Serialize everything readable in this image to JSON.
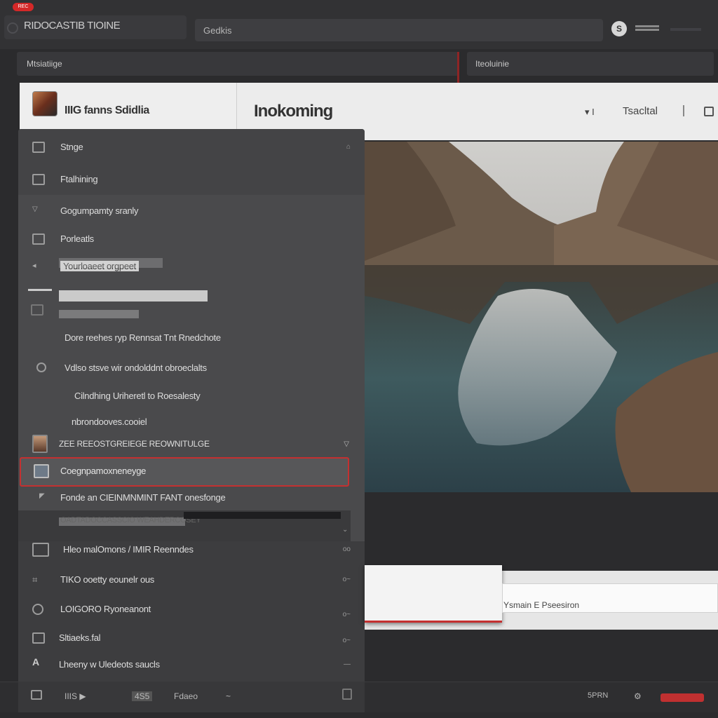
{
  "topbar": {
    "badge": "REC",
    "app_title": "RIDOCASTIB TIOINE",
    "search_text": "Gedkis",
    "circle_icon": "S",
    "menu_icon": "menu-icon"
  },
  "crumbs": {
    "left": "Mtsiatiige",
    "right": "Iteoluinie"
  },
  "header": {
    "studio_name": "IIIG fanns Sdidlia",
    "title": "Inokoming",
    "icon1": "▾ I",
    "link": "Tsacltal",
    "icon2": "layout-icon"
  },
  "sidebar": {
    "top_items": [
      {
        "label": "Stnge",
        "right": "⌂"
      },
      {
        "label": "Ftalhining",
        "right": ""
      }
    ],
    "items": [
      {
        "label": "Gogumpamty sranly",
        "right": ""
      },
      {
        "label": "Porleatls",
        "right": ""
      },
      {
        "label": "Yourloaeet orgpeet",
        "right": ""
      },
      {
        "label": "",
        "right": ""
      },
      {
        "label": "",
        "right": ""
      },
      {
        "label": "Dore reehes ryp Rennsat Tnt Rnedchote",
        "right": ""
      },
      {
        "label": "Vdlso stsve wir ondolddnt obroeclalts",
        "right": ""
      },
      {
        "label": "Cilndhing Uriheretl to Roesalesty",
        "right": ""
      },
      {
        "label": "nbrondooves.cooiel",
        "right": ""
      },
      {
        "label": "ZEE REEOSTGREIEGE REOWNITULGE",
        "right": "▽"
      },
      {
        "label": "Coegnpamoxneneyge",
        "right": ""
      },
      {
        "label": "Fonde an CIEINMNMINT FANT onesfonge",
        "right": ""
      },
      {
        "label": "OADTADOCCASSCIO WEAHDERCOSEY",
        "right": "⌄"
      }
    ],
    "lower_items": [
      {
        "label": "Hleo malOmons / IMIR Reenndes",
        "right": "oo"
      },
      {
        "label": "TIKO ooetty eounelr ous",
        "right": "o~"
      },
      {
        "label": "LOIGORO Ryoneanont",
        "right": "o~"
      },
      {
        "label": "Sltiaeks.fal",
        "right": "o~"
      },
      {
        "label": "Lheeny w Uledeots saucls",
        "right": "—"
      }
    ]
  },
  "panel": {
    "field_text": "Ysmain E Pseesiron"
  },
  "bottombar": {
    "items": [
      "IIIS ▶",
      "4S5",
      "Fdaeo",
      "~",
      "5PRN",
      "⚙"
    ]
  }
}
